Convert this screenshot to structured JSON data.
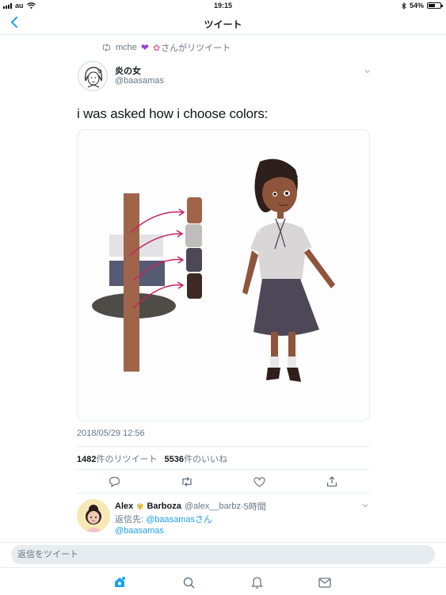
{
  "statusbar": {
    "carrier": "au",
    "time": "19:15",
    "battery": "54%",
    "battery_level": 0.54
  },
  "navbar": {
    "title": "ツイート"
  },
  "retweet_context": {
    "label": "mche",
    "suffix": "さんがリツイート"
  },
  "tweet": {
    "author_name": "炎の女",
    "author_handle": "@baasamas",
    "text": "i was asked how i choose colors:",
    "timestamp": "2018/05/29 12:56",
    "retweets_count": "1482",
    "retweets_label": "件のリツイート",
    "likes_count": "5536",
    "likes_label": "件のいいね"
  },
  "reply": {
    "name_first": "Alex",
    "name_second": "Barboza",
    "handle": "@alex__barbz",
    "time": "·5時間",
    "reply_to_label": "返信先:",
    "reply_to_user": "@baasamasさん",
    "body": "@baasamas"
  },
  "compose": {
    "placeholder": "返信をツイート"
  },
  "colors": {
    "accent": "#1da1f2",
    "secondary_text": "#657786",
    "swatch_skin": "#a0644a",
    "swatch_shirt": "#c2bdbd",
    "swatch_skirt": "#4d4758",
    "swatch_hair": "#3d2a24",
    "arrow": "#c6245e"
  },
  "icons": [
    "signal-icon",
    "wifi-icon",
    "bluetooth-icon",
    "battery-icon",
    "back-chevron-icon",
    "retweet-icon",
    "heart-emoji",
    "flower-emoji",
    "chevron-down-icon",
    "reply-icon",
    "like-icon",
    "share-icon",
    "home-icon",
    "search-icon",
    "notifications-icon",
    "messages-icon",
    "sunflower-emoji"
  ]
}
